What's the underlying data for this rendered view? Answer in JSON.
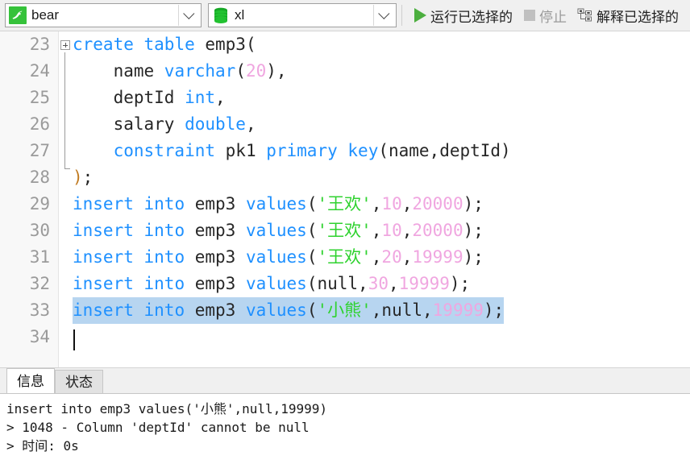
{
  "toolbar": {
    "connection": {
      "value": "bear",
      "icon": "dolphin-icon"
    },
    "database": {
      "value": "xl",
      "icon": "database-icon"
    },
    "run_selected": {
      "label": "运行已选择的",
      "icon": "play-icon",
      "enabled": true
    },
    "stop": {
      "label": "停止",
      "icon": "stop-icon",
      "enabled": false
    },
    "explain_selected": {
      "label": "解释已选择的",
      "icon": "explain-tree-icon",
      "enabled": true
    }
  },
  "editor": {
    "first_line_number": 23,
    "selected_line_number": 33,
    "caret_line_number": 34,
    "colors": {
      "keyword": "#1e90ff",
      "number": "#f0a6e0",
      "string": "#2fd22f",
      "identifier": "#262626",
      "paren_match": "#c07a20",
      "selection": "#b7d5f0",
      "gutter_bg": "#f8f8f8",
      "line_number": "#9a9a9a"
    },
    "lines": [
      {
        "n": "23",
        "tokens": [
          {
            "t": "create",
            "c": "kw"
          },
          {
            "t": " ",
            "c": "idn"
          },
          {
            "t": "table",
            "c": "kw"
          },
          {
            "t": " emp3(",
            "c": "idn"
          }
        ]
      },
      {
        "n": "24",
        "tokens": [
          {
            "t": "    name ",
            "c": "idn"
          },
          {
            "t": "varchar",
            "c": "kw"
          },
          {
            "t": "(",
            "c": "idn"
          },
          {
            "t": "20",
            "c": "num"
          },
          {
            "t": "),",
            "c": "idn"
          }
        ]
      },
      {
        "n": "25",
        "tokens": [
          {
            "t": "    deptId ",
            "c": "idn"
          },
          {
            "t": "int",
            "c": "kw"
          },
          {
            "t": ",",
            "c": "idn"
          }
        ]
      },
      {
        "n": "26",
        "tokens": [
          {
            "t": "    salary ",
            "c": "idn"
          },
          {
            "t": "double",
            "c": "kw"
          },
          {
            "t": ",",
            "c": "idn"
          }
        ]
      },
      {
        "n": "27",
        "tokens": [
          {
            "t": "    ",
            "c": "idn"
          },
          {
            "t": "constraint",
            "c": "kw"
          },
          {
            "t": " pk1 ",
            "c": "idn"
          },
          {
            "t": "primary",
            "c": "kw"
          },
          {
            "t": " ",
            "c": "idn"
          },
          {
            "t": "key",
            "c": "kw"
          },
          {
            "t": "(name,deptId)",
            "c": "idn"
          }
        ]
      },
      {
        "n": "28",
        "tokens": [
          {
            "t": ")",
            "c": "par"
          },
          {
            "t": ";",
            "c": "idn"
          }
        ]
      },
      {
        "n": "29",
        "tokens": [
          {
            "t": "insert",
            "c": "kw"
          },
          {
            "t": " ",
            "c": "idn"
          },
          {
            "t": "into",
            "c": "kw"
          },
          {
            "t": " emp3 ",
            "c": "idn"
          },
          {
            "t": "values",
            "c": "kw"
          },
          {
            "t": "(",
            "c": "idn"
          },
          {
            "t": "'王欢'",
            "c": "str"
          },
          {
            "t": ",",
            "c": "idn"
          },
          {
            "t": "10",
            "c": "num"
          },
          {
            "t": ",",
            "c": "idn"
          },
          {
            "t": "20000",
            "c": "num"
          },
          {
            "t": ");",
            "c": "idn"
          }
        ]
      },
      {
        "n": "30",
        "tokens": [
          {
            "t": "insert",
            "c": "kw"
          },
          {
            "t": " ",
            "c": "idn"
          },
          {
            "t": "into",
            "c": "kw"
          },
          {
            "t": " emp3 ",
            "c": "idn"
          },
          {
            "t": "values",
            "c": "kw"
          },
          {
            "t": "(",
            "c": "idn"
          },
          {
            "t": "'王欢'",
            "c": "str"
          },
          {
            "t": ",",
            "c": "idn"
          },
          {
            "t": "10",
            "c": "num"
          },
          {
            "t": ",",
            "c": "idn"
          },
          {
            "t": "20000",
            "c": "num"
          },
          {
            "t": ");",
            "c": "idn"
          }
        ]
      },
      {
        "n": "31",
        "tokens": [
          {
            "t": "insert",
            "c": "kw"
          },
          {
            "t": " ",
            "c": "idn"
          },
          {
            "t": "into",
            "c": "kw"
          },
          {
            "t": " emp3 ",
            "c": "idn"
          },
          {
            "t": "values",
            "c": "kw"
          },
          {
            "t": "(",
            "c": "idn"
          },
          {
            "t": "'王欢'",
            "c": "str"
          },
          {
            "t": ",",
            "c": "idn"
          },
          {
            "t": "20",
            "c": "num"
          },
          {
            "t": ",",
            "c": "idn"
          },
          {
            "t": "19999",
            "c": "num"
          },
          {
            "t": ");",
            "c": "idn"
          }
        ]
      },
      {
        "n": "32",
        "tokens": [
          {
            "t": "insert",
            "c": "kw"
          },
          {
            "t": " ",
            "c": "idn"
          },
          {
            "t": "into",
            "c": "kw"
          },
          {
            "t": " emp3 ",
            "c": "idn"
          },
          {
            "t": "values",
            "c": "kw"
          },
          {
            "t": "(",
            "c": "idn"
          },
          {
            "t": "null",
            "c": "idn"
          },
          {
            "t": ",",
            "c": "idn"
          },
          {
            "t": "30",
            "c": "num"
          },
          {
            "t": ",",
            "c": "idn"
          },
          {
            "t": "19999",
            "c": "num"
          },
          {
            "t": ");",
            "c": "idn"
          }
        ]
      },
      {
        "n": "33",
        "selected": true,
        "tokens": [
          {
            "t": "insert",
            "c": "kw"
          },
          {
            "t": " ",
            "c": "idn"
          },
          {
            "t": "into",
            "c": "kw"
          },
          {
            "t": " emp3 ",
            "c": "idn"
          },
          {
            "t": "values",
            "c": "kw"
          },
          {
            "t": "(",
            "c": "idn"
          },
          {
            "t": "'小熊'",
            "c": "str"
          },
          {
            "t": ",",
            "c": "idn"
          },
          {
            "t": "null",
            "c": "idn"
          },
          {
            "t": ",",
            "c": "idn"
          },
          {
            "t": "19999",
            "c": "num"
          },
          {
            "t": ");",
            "c": "idn"
          }
        ]
      },
      {
        "n": "34",
        "tokens": []
      }
    ]
  },
  "bottom_panel": {
    "tabs": [
      {
        "label": "信息",
        "active": true
      },
      {
        "label": "状态",
        "active": false
      }
    ],
    "messages": [
      "insert into emp3 values('小熊',null,19999)",
      "> 1048 - Column 'deptId' cannot be null",
      "> 时间: 0s"
    ]
  }
}
